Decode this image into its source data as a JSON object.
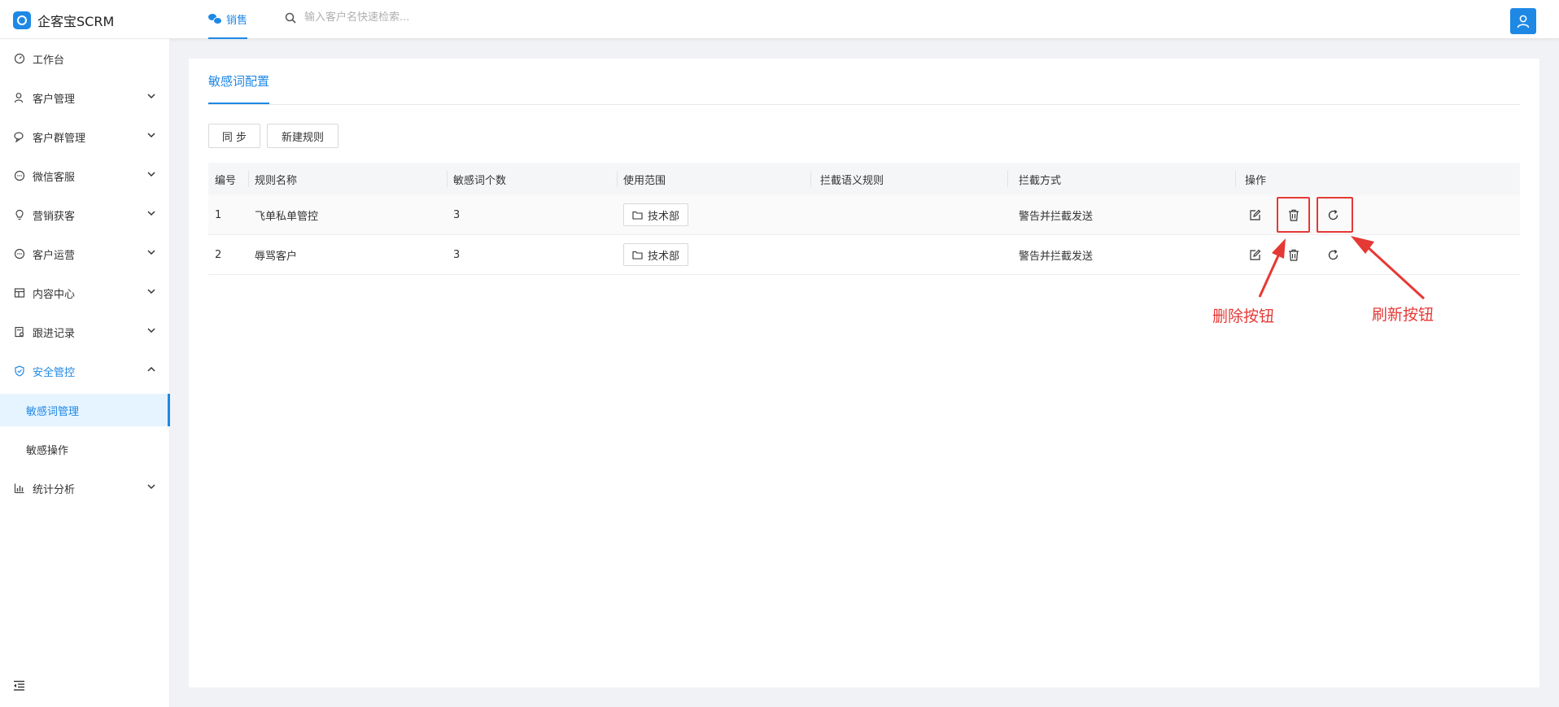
{
  "app": {
    "name": "企客宝SCRM"
  },
  "header": {
    "tab_label": "销售",
    "search_placeholder": "输入客户名快速检索..."
  },
  "sidebar": {
    "items": [
      {
        "label": "工作台",
        "icon": "dashboard-icon"
      },
      {
        "label": "客户管理",
        "icon": "customer-icon"
      },
      {
        "label": "客户群管理",
        "icon": "group-chat-icon"
      },
      {
        "label": "微信客服",
        "icon": "wechat-service-icon"
      },
      {
        "label": "营销获客",
        "icon": "bulb-icon"
      },
      {
        "label": "客户运营",
        "icon": "operation-icon"
      },
      {
        "label": "内容中心",
        "icon": "content-icon"
      },
      {
        "label": "跟进记录",
        "icon": "record-icon"
      },
      {
        "label": "安全管控",
        "icon": "shield-icon"
      },
      {
        "label": "统计分析",
        "icon": "bar-chart-icon"
      }
    ],
    "sub_items": [
      {
        "label": "敏感词管理",
        "active": true
      },
      {
        "label": "敏感操作",
        "active": false
      }
    ]
  },
  "page": {
    "tab_label": "敏感词配置",
    "buttons": {
      "sync": "同 步",
      "new_rule": "新建规则"
    }
  },
  "table": {
    "columns": [
      "编号",
      "规则名称",
      "敏感词个数",
      "使用范围",
      "拦截语义规则",
      "拦截方式",
      "操作"
    ],
    "rows": [
      {
        "id": "1",
        "name": "飞单私单管控",
        "count": "3",
        "scope": "技术部",
        "semantic": "",
        "method": "警告并拦截发送"
      },
      {
        "id": "2",
        "name": "辱骂客户",
        "count": "3",
        "scope": "技术部",
        "semantic": "",
        "method": "警告并拦截发送"
      }
    ]
  },
  "annotations": {
    "delete_label": "删除按钮",
    "refresh_label": "刷新按钮",
    "color": "#e53935"
  },
  "colors": {
    "accent": "#1e88e5",
    "annotation": "#e53935"
  }
}
